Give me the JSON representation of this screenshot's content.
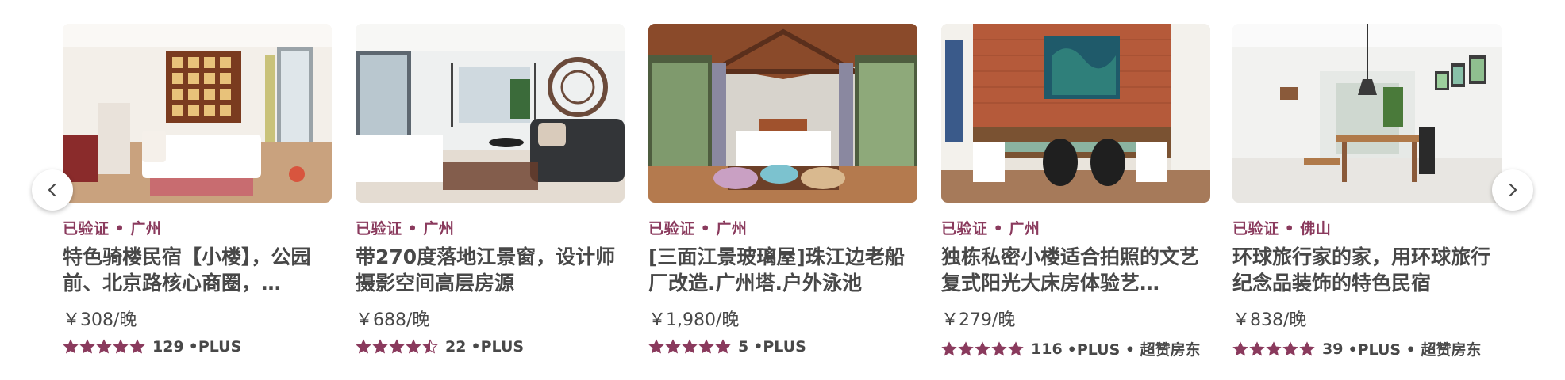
{
  "colors": {
    "accent": "#8a3a5d",
    "text": "#484848"
  },
  "nav": {
    "prev_icon": "chevron-left-icon",
    "next_icon": "chevron-right-icon"
  },
  "listings": [
    {
      "meta": "已验证 • 广州",
      "title": "特色骑楼民宿【小楼】，公园前、北京路核心商圈，…",
      "price": "￥308/晚",
      "rating_value": 5,
      "reviews": "129",
      "badges": "•PLUS"
    },
    {
      "meta": "已验证 • 广州",
      "title": "带270度落地江景窗，设计师摄影空间高层房源",
      "price": "￥688/晚",
      "rating_value": 4.5,
      "reviews": "22",
      "badges": "•PLUS"
    },
    {
      "meta": "已验证 • 广州",
      "title": "[三面江景玻璃屋]珠江边老船厂改造.广州塔.户外泳池",
      "price": "￥1,980/晚",
      "rating_value": 5,
      "reviews": "5",
      "badges": "•PLUS"
    },
    {
      "meta": "已验证 • 广州",
      "title": "独栋私密小楼适合拍照的文艺复式阳光大床房体验艺…",
      "price": "￥279/晚",
      "rating_value": 5,
      "reviews": "116",
      "badges": "•PLUS • 超赞房东"
    },
    {
      "meta": "已验证 • 佛山",
      "title": "环球旅行家的家，用环球旅行纪念品装饰的特色民宿",
      "price": "￥838/晚",
      "rating_value": 5,
      "reviews": "39",
      "badges": "•PLUS • 超赞房东"
    }
  ]
}
